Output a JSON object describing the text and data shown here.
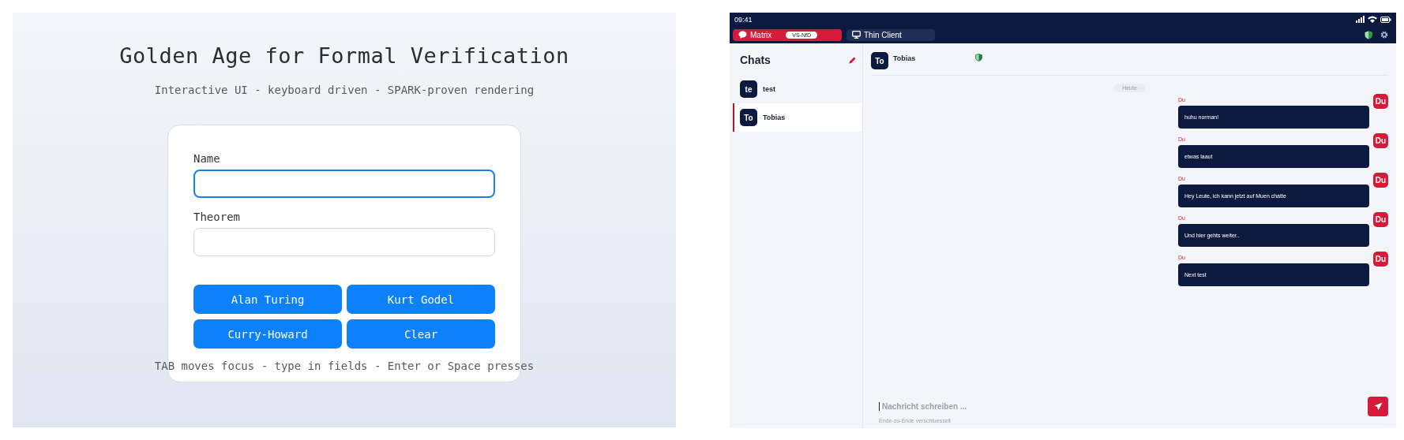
{
  "demo": {
    "title": "Golden Age for Formal Verification",
    "subtitle": "Interactive UI - keyboard driven - SPARK-proven rendering",
    "fields": [
      {
        "label": "Name",
        "focused": true
      },
      {
        "label": "Theorem",
        "focused": false
      }
    ],
    "buttons": [
      "Alan Turing",
      "Kurt Godel",
      "Curry-Howard",
      "Clear"
    ],
    "hint": "TAB moves focus - type in fields - Enter or Space presses"
  },
  "chat_app": {
    "status_bar": {
      "time": "09:41"
    },
    "tabs": [
      {
        "kind": "chat",
        "label": "Matrix",
        "badge": "VS-NfD",
        "selected": true
      },
      {
        "kind": "monitor",
        "label": "Thin Client",
        "selected": false
      }
    ],
    "sidebar": {
      "title": "Chats",
      "items": [
        {
          "initials": "te",
          "name": "test",
          "selected": false
        },
        {
          "initials": "To",
          "name": "Tobias",
          "selected": true
        }
      ]
    },
    "conversation": {
      "avatar": "To",
      "name": "Tobias",
      "date": "Heute",
      "messages": [
        {
          "sender": "Du",
          "avatar": "Du",
          "text": "huhu norman!"
        },
        {
          "sender": "Du",
          "avatar": "Du",
          "text": "etwas laaut"
        },
        {
          "sender": "Du",
          "avatar": "Du",
          "text": "Hey Leute, ich  kann jetzt auf Muen chatte"
        },
        {
          "sender": "Du",
          "avatar": "Du",
          "text": "Und hier gehts weiter.."
        },
        {
          "sender": "Du",
          "avatar": "Du",
          "text": "Next test"
        }
      ],
      "composer": {
        "placeholder": "Nachricht schreiben ...",
        "note": "Ende-zu-Ende verschluesselt"
      }
    }
  }
}
